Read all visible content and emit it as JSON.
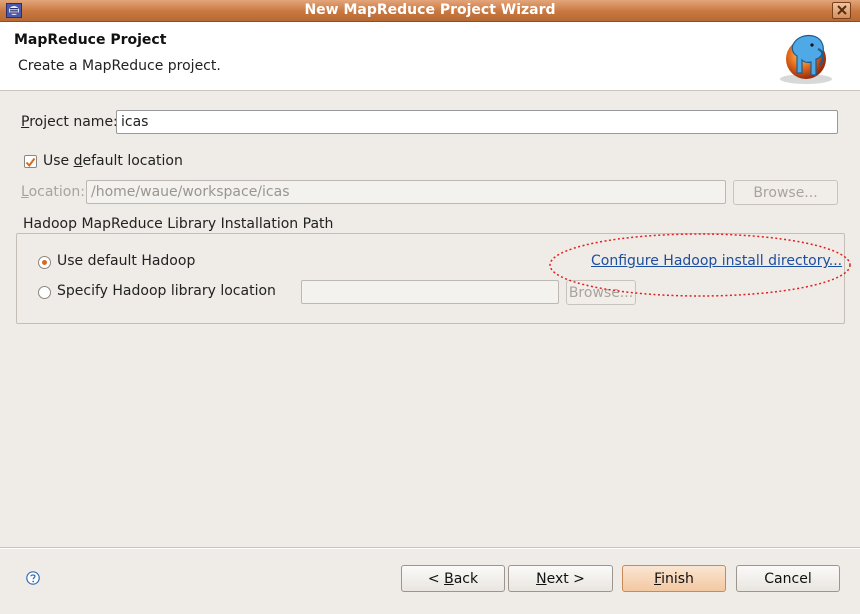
{
  "window": {
    "title": "New MapReduce Project Wizard"
  },
  "header": {
    "title": "MapReduce Project",
    "description": "Create a MapReduce project."
  },
  "project_name": {
    "label_pre": "",
    "label_mnemonic": "P",
    "label_post": "roject name:",
    "value": "icas"
  },
  "default_location": {
    "label_pre": "Use ",
    "label_mnemonic": "d",
    "label_post": "efault location",
    "checked": true
  },
  "location": {
    "label_pre": "",
    "label_mnemonic": "L",
    "label_post": "ocation:",
    "value": "/home/waue/workspace/icas",
    "browse_label": "Browse..."
  },
  "hadoop_group": {
    "title": "Hadoop MapReduce Library Installation Path",
    "option_default": "Use default Hadoop",
    "option_specify": "Specify Hadoop library location",
    "selected": "default",
    "configure_link": "Configure Hadoop install directory...",
    "library_location_value": "",
    "browse_label": "Browse..."
  },
  "footer": {
    "back_pre": "< ",
    "back_mnemonic": "B",
    "back_post": "ack",
    "next_mnemonic": "N",
    "next_post": "ext >",
    "finish_mnemonic": "F",
    "finish_post": "inish",
    "cancel_label": "Cancel"
  },
  "colors": {
    "titlebar": "#c8773f",
    "link": "#1c4fa0",
    "annotation_ellipse": "#e02020",
    "radio_selected": "#d76a1d"
  }
}
